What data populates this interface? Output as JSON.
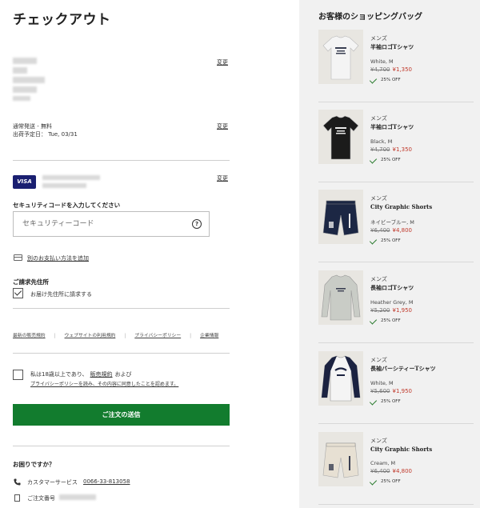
{
  "page_title": "チェックアウト",
  "change_label": "変更",
  "shipping": {
    "method": "通常発送 - 無料",
    "ship_date": "出荷予定日： Tue, 03/31"
  },
  "payment": {
    "card_brand": "VISA",
    "security_label": "セキュリティコードを入力してください",
    "security_placeholder": "セキュリティーコード",
    "help_glyph": "?",
    "add_payment": "別のお支払い方法を追加"
  },
  "billing": {
    "title": "ご請求先住所",
    "same_as_shipping": "お届け先住所に請求する"
  },
  "footer_links": [
    "最新の販売規約",
    "ウェブサイトの利用規約",
    "プライバシーポリシー",
    "企業情報"
  ],
  "consent": {
    "line1_prefix": "私は18歳以上であり、",
    "line1_link": "販売規約",
    "line1_suffix": "および",
    "line2": "プライバシーポリシーを読み、その内容に同意したことを認めます。"
  },
  "submit_label": "ご注文の送信",
  "help": {
    "title": "お困りですか？",
    "customer_service_label": "カスタマーサービス",
    "phone": "0066-33-813058",
    "order_number_label": "ご注文番号"
  },
  "cart": {
    "title": "お客様のショッピングバッグ",
    "items": [
      {
        "category": "メンズ",
        "name": "半袖ロゴTシャツ",
        "variant": "White, M",
        "old_price": "¥4,700",
        "new_price": "¥1,350",
        "discount": "25% OFF",
        "product_color": "#f4f4f4",
        "thumb_type": "tshirt"
      },
      {
        "category": "メンズ",
        "name": "半袖ロゴTシャツ",
        "variant": "Black, M",
        "old_price": "¥4,700",
        "new_price": "¥1,350",
        "discount": "25% OFF",
        "product_color": "#1b1b1b",
        "thumb_type": "tshirt"
      },
      {
        "category": "メンズ",
        "name": "City Graphic Shorts",
        "variant": "ネイビーブルー, M",
        "old_price": "¥6,400",
        "new_price": "¥4,800",
        "discount": "25% OFF",
        "product_color": "#1c2744",
        "thumb_type": "shorts"
      },
      {
        "category": "メンズ",
        "name": "長袖ロゴTシャツ",
        "variant": "Heather Grey, M",
        "old_price": "¥5,200",
        "new_price": "¥1,950",
        "discount": "25% OFF",
        "product_color": "#c9ccc6",
        "thumb_type": "longsleeve"
      },
      {
        "category": "メンズ",
        "name": "長袖バーシティーTシャツ",
        "variant": "White, M",
        "old_price": "¥5,600",
        "new_price": "¥1,950",
        "discount": "25% OFF",
        "product_color": "#f4f4f4",
        "thumb_type": "raglan"
      },
      {
        "category": "メンズ",
        "name": "City Graphic Shorts",
        "variant": "Cream, M",
        "old_price": "¥6,400",
        "new_price": "¥4,800",
        "discount": "25% OFF",
        "product_color": "#e7e0d3",
        "thumb_type": "shorts"
      }
    ]
  }
}
